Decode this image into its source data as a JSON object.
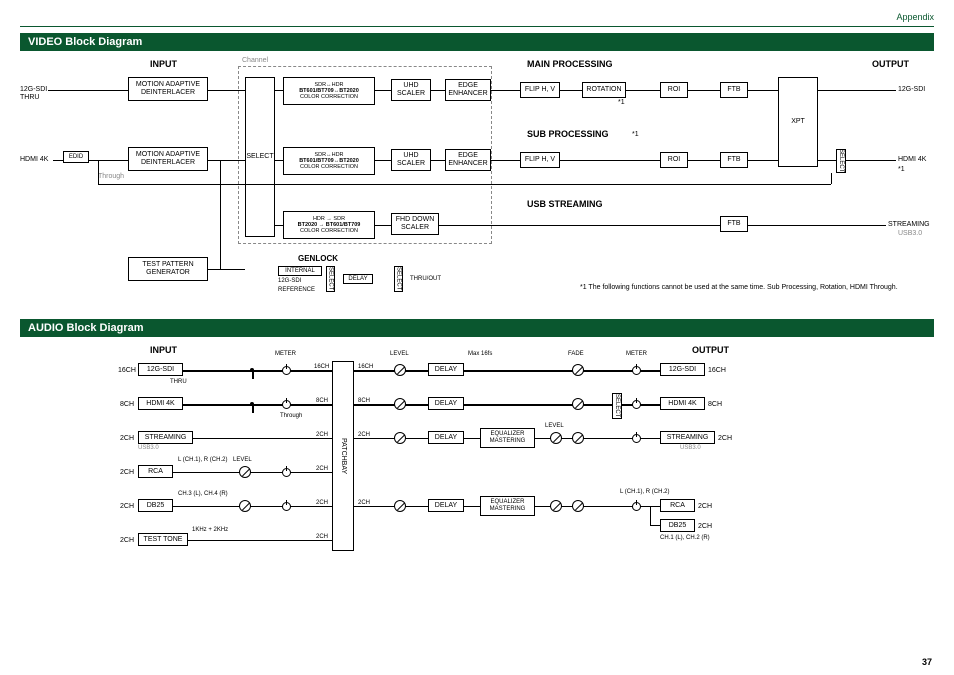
{
  "appendix": "Appendix",
  "video": {
    "title": "VIDEO Block Diagram",
    "headers": {
      "input": "INPUT",
      "main": "MAIN PROCESSING",
      "sub": "SUB PROCESSING",
      "usb": "USB STREAMING",
      "output": "OUTPUT",
      "genlock": "GENLOCK"
    },
    "sub_note": "*1",
    "inputs": {
      "sdi": "12G-SDI",
      "thru": "THRU",
      "hdmi": "HDMI 4K",
      "edid": "EDID",
      "through": "Through"
    },
    "blocks": {
      "mad1": "MOTION ADAPTIVE DEINTERLACER",
      "mad2": "MOTION ADAPTIVE DEINTERLACER",
      "select": "SELECT",
      "cc1a": "SDR↔HDR",
      "cc1b": "BT601/BT709↔BT2020",
      "cc1c": "COLOR CORRECTION",
      "uhd1": "UHD SCALER",
      "edge1": "EDGE ENHANCER",
      "flip1": "FLIP H, V",
      "rot": "ROTATION",
      "roi1": "ROI",
      "ftb1": "FTB",
      "cc2a": "SDR↔HDR",
      "cc2b": "BT601/BT709↔BT2020",
      "cc2c": "COLOR CORRECTION",
      "uhd2": "UHD SCALER",
      "edge2": "EDGE ENHANCER",
      "flip2": "FLIP H, V",
      "roi2": "ROI",
      "ftb2": "FTB",
      "cc3a": "HDR → SDR",
      "cc3b": "BT2020 → BT601/BT709",
      "cc3c": "COLOR CORRECTION",
      "fhd": "FHD DOWN SCALER",
      "ftb3": "FTB",
      "xpt": "XPT",
      "tpg": "TEST PATTERN GENERATOR",
      "internal": "INTERNAL",
      "g_sdi": "12G-SDI",
      "reference": "REFERENCE",
      "select_s": "SELECT",
      "delay": "DELAY",
      "thruout": "THRU/OUT",
      "select_out": "SELECT"
    },
    "outputs": {
      "sdi": "12G-SDI",
      "hdmi": "HDMI 4K",
      "hdmi_note": "*1",
      "streaming": "STREAMING",
      "usb": "USB3.0"
    },
    "channel": "Channel",
    "rot_note": "*1",
    "footnote": "*1 The following functions cannot be used at the same time. Sub Processing, Rotation, HDMI Through."
  },
  "audio": {
    "title": "AUDIO Block Diagram",
    "headers": {
      "input": "INPUT",
      "output": "OUTPUT"
    },
    "patchbay": "PATCHBAY",
    "in": {
      "sdi": "12G-SDI",
      "sdi_ch": "16CH",
      "thru": "THRU",
      "hdmi": "HDMI 4K",
      "hdmi_ch": "8CH",
      "through": "Through",
      "streaming": "STREAMING",
      "str_ch": "2CH",
      "usb": "USB3.0",
      "rca": "RCA",
      "rca_ch": "2CH",
      "rca_lbl": "L (CH.1), R (CH.2)",
      "db25": "DB25",
      "db25_ch": "2CH",
      "db25_lbl": "CH.3 (L), CH.4 (R)",
      "tt": "TEST TONE",
      "tt_ch": "2CH",
      "tt_lbl": "1KHz + 2KHz"
    },
    "labels": {
      "meter": "METER",
      "level": "LEVEL",
      "max": "Max 16fs",
      "fade": "FADE",
      "select": "SELECT"
    },
    "delay": "DELAY",
    "eq": "EQUALIZER MASTERING",
    "out": {
      "sdi": "12G-SDI",
      "sdi_ch": "16CH",
      "hdmi": "HDMI 4K",
      "hdmi_ch": "8CH",
      "streaming": "STREAMING",
      "str_ch": "2CH",
      "usb": "USB3.0",
      "rca": "RCA",
      "rca_ch": "2CH",
      "rca_lbl": "L (CH.1), R (CH.2)",
      "db25": "DB25",
      "db25_ch": "2CH",
      "db25_lbl": "CH.1 (L), CH.2 (R)"
    },
    "counts": {
      "pb_in_16": "16CH",
      "pb_in_8": "8CH",
      "pb_in_2": "2CH"
    }
  },
  "page": "37"
}
